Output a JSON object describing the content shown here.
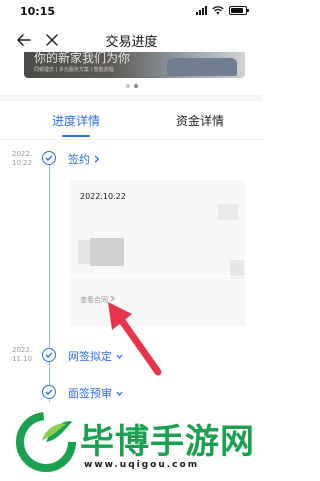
{
  "status_bar": {
    "time": "10:15"
  },
  "nav": {
    "title": "交易进度"
  },
  "banner": {
    "title": "你的新家我们为你",
    "subtitle": "同频理念 | 多元服务方案 | 智能流程"
  },
  "tabs": [
    {
      "label": "进度详情",
      "active": true
    },
    {
      "label": "资金详情",
      "active": false
    }
  ],
  "timeline": [
    {
      "date_line1": "2022.",
      "date_line2": "10.22",
      "label": "签约"
    },
    {
      "date_line1": "2022.",
      "date_line2": "11.10",
      "label": "网签拟定"
    },
    {
      "label": "面签预审"
    }
  ],
  "card": {
    "date": "2022.10.22",
    "link": "查看合同"
  },
  "watermark": {
    "brand": "毕博手游网",
    "url": "www.uqigou.com"
  },
  "colors": {
    "accent": "#2d6fe0",
    "arrow": "#e8344a",
    "watermark": "#1aa14f"
  }
}
